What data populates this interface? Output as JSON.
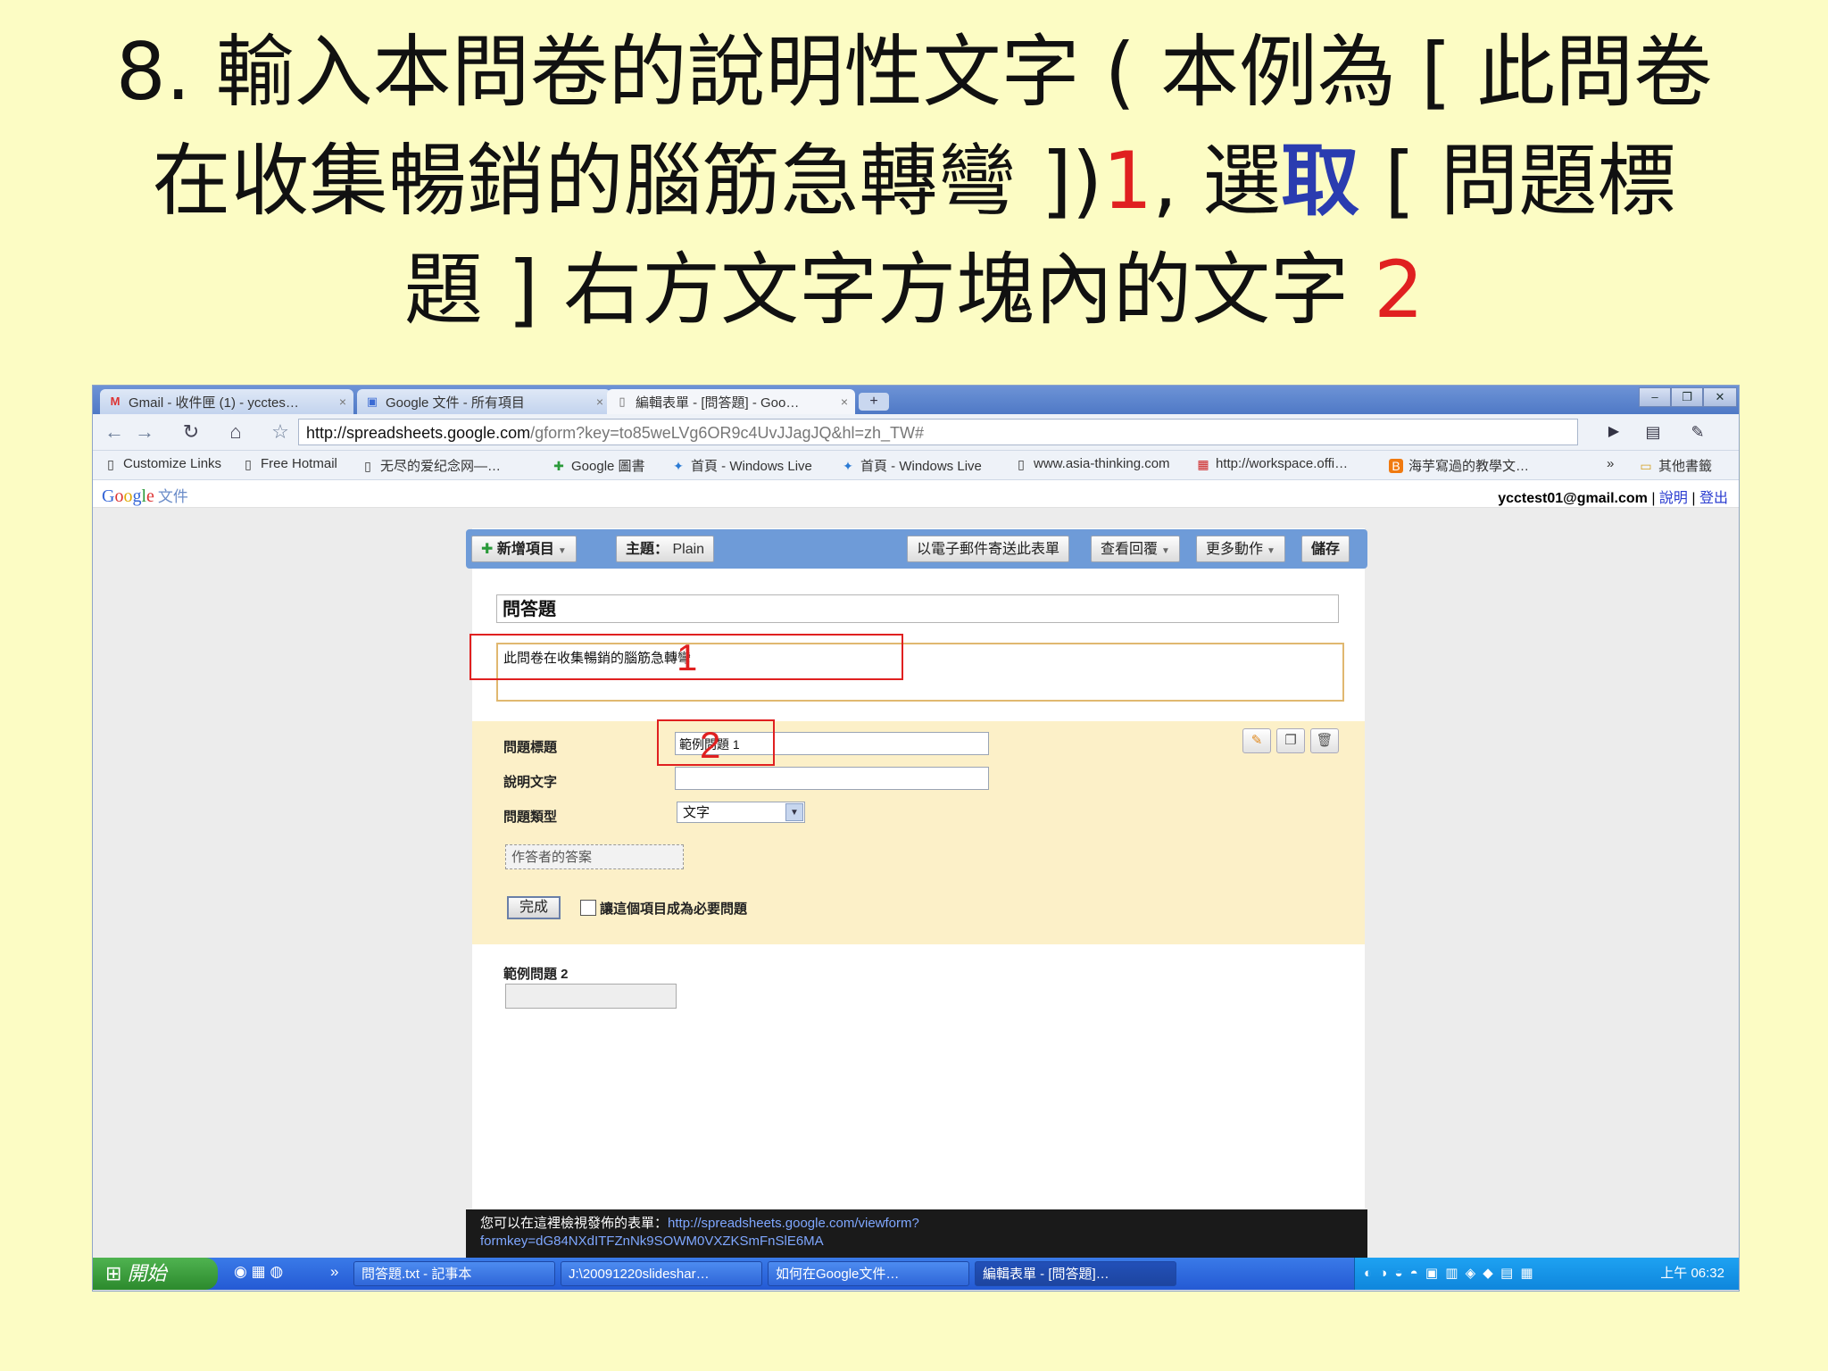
{
  "slide": {
    "line1": "8. 輸入本問卷的說明性文字 ( 本例為 [ 此問卷",
    "line2_a": "在收集暢銷的腦筋急轉彎 ])",
    "line2_num": "1",
    "line2_b": ", 選",
    "line2_blue": "取",
    "line2_c": " [ 問題標",
    "line3_a": "題 ] 右方文字方塊內的文字 ",
    "line3_num": "2"
  },
  "browser": {
    "tabs": [
      {
        "icon": "gmail-icon",
        "label": "Gmail - 收件匣 (1) - ycctes…",
        "close": "×"
      },
      {
        "icon": "google-docs-icon",
        "label": "Google 文件 - 所有項目",
        "close": "×"
      },
      {
        "icon": "page-icon",
        "label": "編輯表單 - [問答題] - Goo…",
        "close": "×"
      }
    ],
    "new_tab": "+",
    "window_controls": {
      "minimize": "–",
      "restore": "❐",
      "close": "✕"
    },
    "url_host": "http://spreadsheets.google.com",
    "url_path": "/gform?key=to85weLVg6OR9c4UvJJagJQ&hl=zh_TW#",
    "bookmarks": [
      "Customize Links",
      "Free Hotmail",
      "无尽的爱纪念网—…",
      "Google 圖書",
      "首頁 - Windows Live",
      "首頁 - Windows Live",
      "www.asia-thinking.com",
      "http://workspace.offi…",
      "海芋寫過的教學文…"
    ],
    "bookmarks_more": "»",
    "other_bookmarks": "其他書籤"
  },
  "google_bar": {
    "logo": [
      "G",
      "o",
      "o",
      "g",
      "l",
      "e"
    ],
    "product": "文件",
    "user": "ycctest01@gmail.com",
    "sep": " | ",
    "help": "說明",
    "logout": "登出"
  },
  "form_toolbar": {
    "add_item": "新增項目",
    "theme_label": "主題：",
    "theme_value": "Plain",
    "email_form": "以電子郵件寄送此表單",
    "view_responses": "查看回覆",
    "more_actions": "更多動作",
    "save": "儲存"
  },
  "form": {
    "title": "問答題",
    "description": "此問卷在收集暢銷的腦筋急轉彎"
  },
  "question_editor": {
    "title_label": "問題標題",
    "title_value": "範例問題 1",
    "help_label": "說明文字",
    "help_value": "",
    "type_label": "問題類型",
    "type_value": "文字",
    "answer_placeholder": "作答者的答案",
    "done": "完成",
    "required_label": "讓這個項目成為必要問題"
  },
  "question2": {
    "label": "範例問題 2"
  },
  "annotations": {
    "marker1": "1",
    "marker2": "2"
  },
  "published_bar": {
    "prefix": "您可以在這裡檢視發佈的表單：",
    "url1": "http://spreadsheets.google.com/viewform?",
    "url2": "formkey=dG84NXdITFZnNk9SOWM0VXZKSmFnSlE6MA"
  },
  "taskbar": {
    "start": "開始",
    "items": [
      "問答題.txt - 記事本",
      "J:\\20091220slideshar…",
      "如何在Google文件…",
      "編輯表單 - [問答題]…"
    ],
    "clock": "上午 06:32"
  }
}
